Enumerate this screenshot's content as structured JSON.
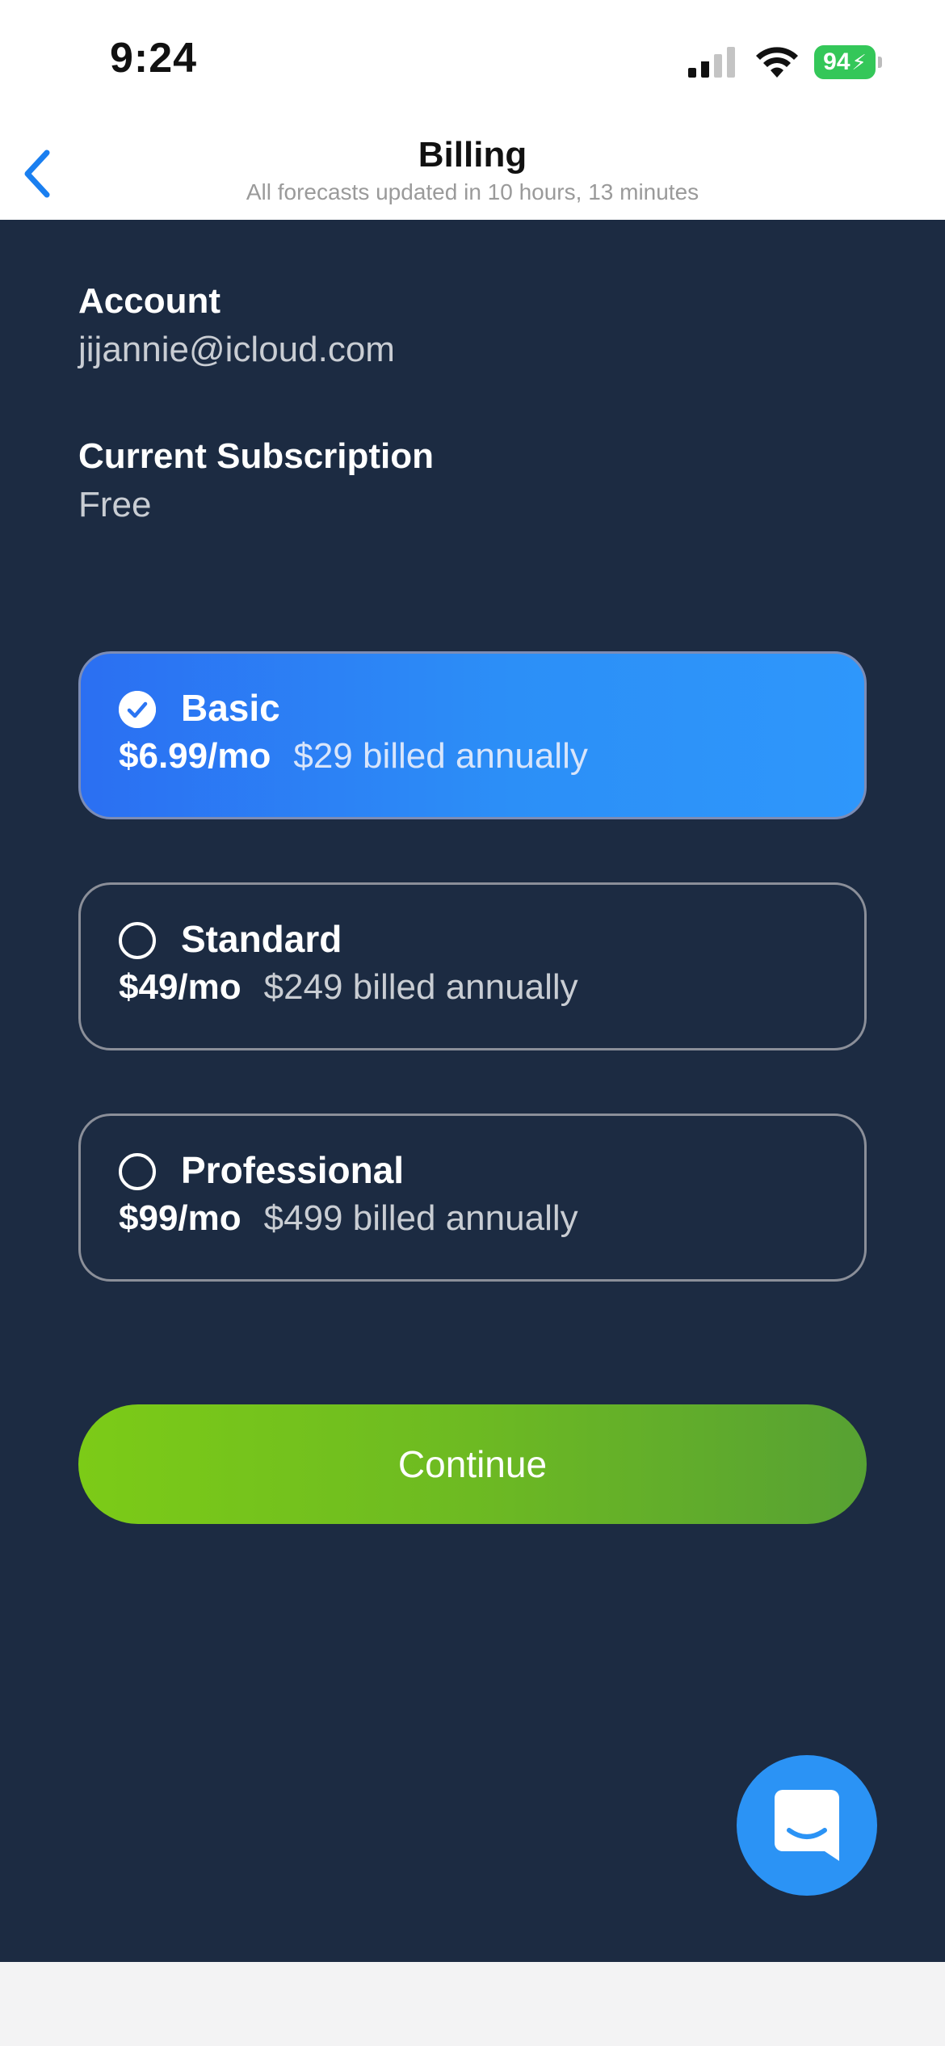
{
  "status_bar": {
    "time": "9:24",
    "battery_text": "94",
    "icons": [
      "signal-icon",
      "wifi-icon",
      "battery-charging-icon"
    ]
  },
  "header": {
    "back_icon": "chevron-left-icon",
    "title": "Billing",
    "subtitle": "All forecasts updated in 10 hours, 13 minutes"
  },
  "account": {
    "label": "Account",
    "value": "jijannie@icloud.com"
  },
  "subscription": {
    "label": "Current Subscription",
    "value": "Free"
  },
  "plans": [
    {
      "name": "Basic",
      "price": "$6.99/mo",
      "annual": "$29 billed annually",
      "selected": true
    },
    {
      "name": "Standard",
      "price": "$49/mo",
      "annual": "$249 billed annually",
      "selected": false
    },
    {
      "name": "Professional",
      "price": "$99/mo",
      "annual": "$499 billed annually",
      "selected": false
    }
  ],
  "continue_label": "Continue",
  "chat_icon": "chat-bubble-icon",
  "colors": {
    "background_dark": "#1c2b42",
    "selected_plan": "#2c8ff7",
    "continue_button": "#6dba22",
    "accent_blue": "#1a7ff0",
    "battery_green": "#34c759"
  }
}
